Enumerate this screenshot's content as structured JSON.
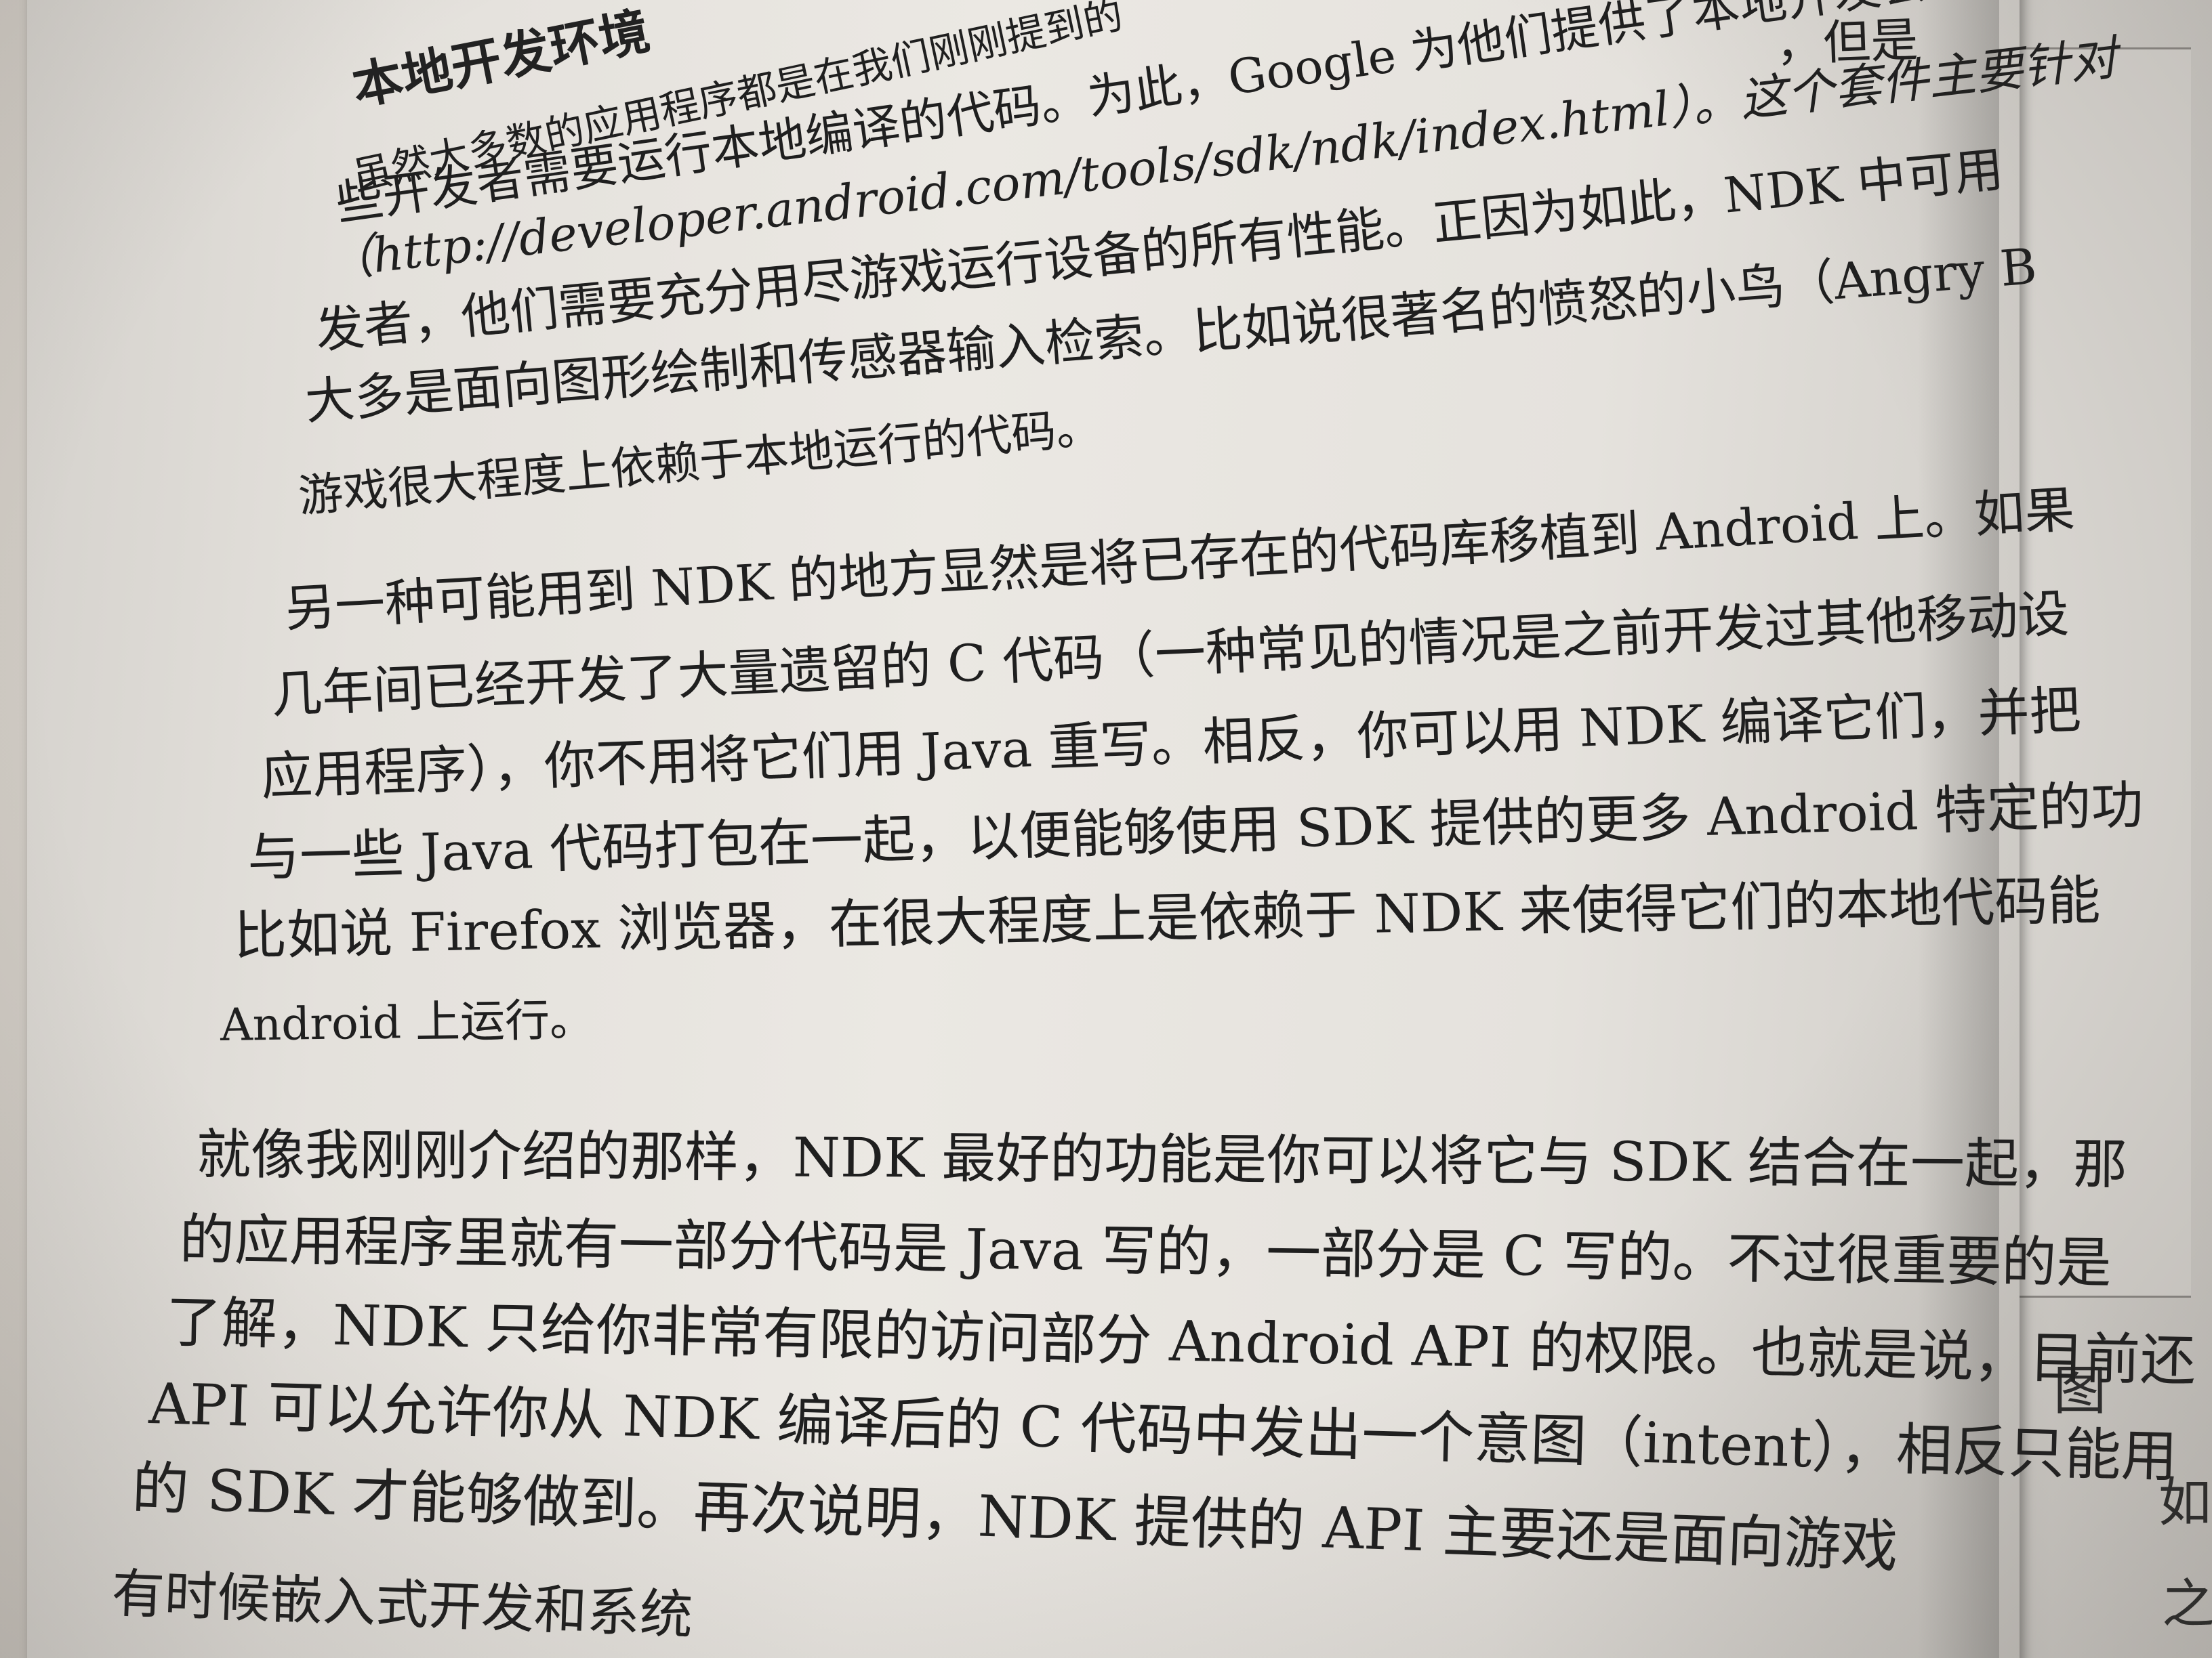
{
  "heading": "本地开发环境",
  "paragraph_1": [
    "虽然大多数的应用程序都是在我们刚刚提到的",
    "些开发者需要运行本地编译的代码。为此，Google 为他们提供了本地开发套件",
    "（http://developer.android.com/tools/sdk/ndk/index.html）。这个套件主要针对",
    "发者，他们需要充分用尽游戏运行设备的所有性能。正因为如此，NDK 中可用",
    "大多是面向图形绘制和传感器输入检索。比如说很著名的愤怒的小鸟（Angry B",
    "游戏很大程度上依赖于本地运行的代码。"
  ],
  "paragraph_2": [
    "另一种可能用到 NDK 的地方显然是将已存在的代码库移植到 Android 上。如果",
    "几年间已经开发了大量遗留的 C 代码（一种常见的情况是之前开发过其他移动设",
    "应用程序），你不用将它们用 Java 重写。相反，你可以用 NDK 编译它们，并把",
    "与一些 Java 代码打包在一起，以便能够使用 SDK 提供的更多 Android 特定的功",
    "比如说 Firefox 浏览器，在很大程度上是依赖于 NDK 来使得它们的本地代码能",
    "Android 上运行。"
  ],
  "paragraph_3": [
    "就像我刚刚介绍的那样，NDK 最好的功能是你可以将它与 SDK 结合在一起，那",
    "的应用程序里就有一部分代码是 Java 写的，一部分是 C 写的。不过很重要的是",
    "了解，NDK 只给你非常有限的访问部分 Android API 的权限。也就是说，目前还",
    "API 可以允许你从 NDK 编译后的 C 代码中发出一个意图（intent），相反只能用",
    "的 SDK 才能够做到。再次说明，NDK 提供的 API 主要还是面向游戏",
    "有时候嵌入式开发和系统"
  ],
  "header_fragment": "，但是",
  "facing_page": {
    "fig_char": "图",
    "char_1": "如",
    "char_2": "之"
  }
}
